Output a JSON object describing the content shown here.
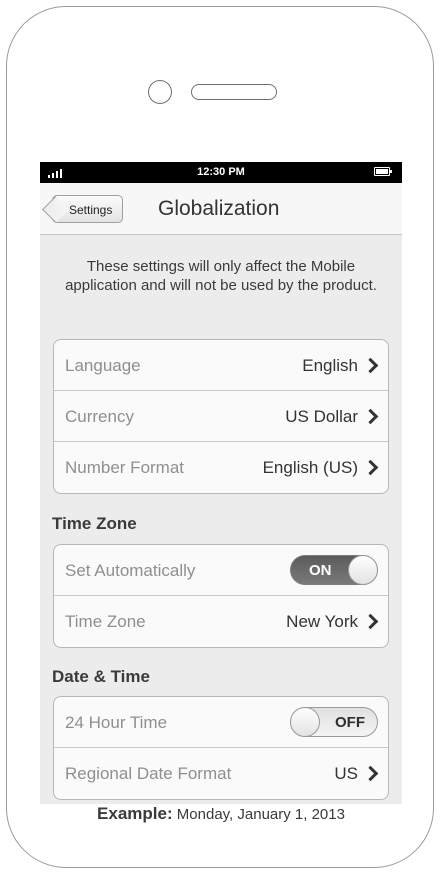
{
  "status_bar": {
    "time": "12:30 PM",
    "signal_icon": "signal-bars-icon",
    "battery_icon": "battery-icon"
  },
  "nav": {
    "back_label": "Settings",
    "title": "Globalization"
  },
  "intro_text": "These settings will only affect the Mobile application and will not be used by the product.",
  "general": {
    "rows": [
      {
        "label": "Language",
        "value": "English"
      },
      {
        "label": "Currency",
        "value": "US Dollar"
      },
      {
        "label": "Number Format",
        "value": "English (US)"
      }
    ]
  },
  "time_zone": {
    "header": "Time Zone",
    "set_automatically": {
      "label": "Set Automatically",
      "toggle": "ON",
      "state": true
    },
    "zone": {
      "label": "Time Zone",
      "value": "New York"
    }
  },
  "date_time": {
    "header": "Date & Time",
    "hour24": {
      "label": "24 Hour Time",
      "toggle": "OFF",
      "state": false
    },
    "regional": {
      "label": "Regional Date Format",
      "value": "US"
    }
  },
  "example": {
    "label": "Example:",
    "value": "Monday, January 1, 2013"
  }
}
